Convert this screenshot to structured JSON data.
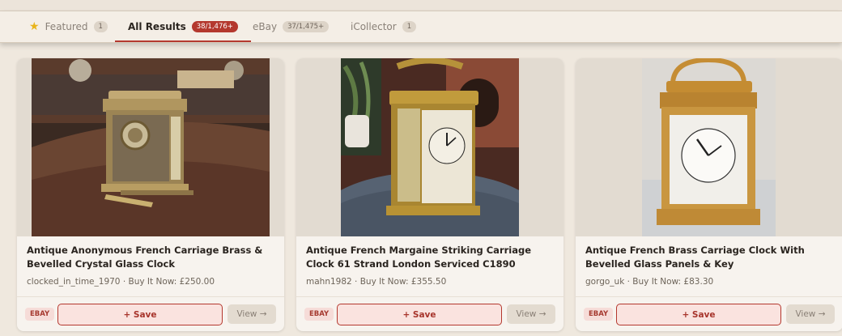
{
  "tabs": [
    {
      "label": "Featured",
      "count": "1",
      "icon": "star-icon"
    },
    {
      "label": "All Results",
      "count": "38/1,476+"
    },
    {
      "label": "eBay",
      "count": "37/1,475+"
    },
    {
      "label": "iCollector",
      "count": "1"
    }
  ],
  "results": [
    {
      "title": "Antique Anonymous French Carriage Brass & Bevelled Crystal Glass Clock",
      "meta": "clocked_in_time_1970 · Buy It Now: £250.00",
      "source": "EBAY",
      "save_label": "+ Save",
      "view_label": "View →"
    },
    {
      "title": "Antique French Margaine Striking Carriage Clock 61 Strand London Serviced C1890",
      "meta": "mahn1982 · Buy It Now: £355.50",
      "source": "EBAY",
      "save_label": "+ Save",
      "view_label": "View →"
    },
    {
      "title": "Antique French Brass Carriage Clock With Bevelled Glass Panels & Key",
      "meta": "gorgo_uk · Buy It Now: £83.30",
      "source": "EBAY",
      "save_label": "+ Save",
      "view_label": "View →"
    }
  ],
  "colors": {
    "accent": "#b4382e",
    "background": "#efe8de",
    "star": "#e8b41c"
  }
}
